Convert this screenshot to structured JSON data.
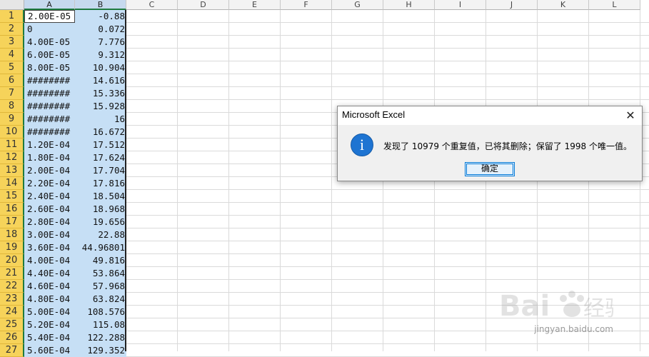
{
  "columns": [
    {
      "label": "A"
    },
    {
      "label": "B"
    },
    {
      "label": "C"
    },
    {
      "label": "D"
    },
    {
      "label": "E"
    },
    {
      "label": "F"
    },
    {
      "label": "G"
    },
    {
      "label": "H"
    },
    {
      "label": "I"
    },
    {
      "label": "J"
    },
    {
      "label": "K"
    },
    {
      "label": "L"
    }
  ],
  "rows": [
    {
      "num": "1",
      "a": "2.00E-05",
      "b": "-0.88"
    },
    {
      "num": "2",
      "a": "0",
      "b": "0.072"
    },
    {
      "num": "3",
      "a": "4.00E-05",
      "b": "7.776"
    },
    {
      "num": "4",
      "a": "6.00E-05",
      "b": "9.312"
    },
    {
      "num": "5",
      "a": "8.00E-05",
      "b": "10.904"
    },
    {
      "num": "6",
      "a": "########",
      "b": "14.616"
    },
    {
      "num": "7",
      "a": "########",
      "b": "15.336"
    },
    {
      "num": "8",
      "a": "########",
      "b": "15.928"
    },
    {
      "num": "9",
      "a": "########",
      "b": "16"
    },
    {
      "num": "10",
      "a": "########",
      "b": "16.672"
    },
    {
      "num": "11",
      "a": "1.20E-04",
      "b": "17.512"
    },
    {
      "num": "12",
      "a": "1.80E-04",
      "b": "17.624"
    },
    {
      "num": "13",
      "a": "2.00E-04",
      "b": "17.704"
    },
    {
      "num": "14",
      "a": "2.20E-04",
      "b": "17.816"
    },
    {
      "num": "15",
      "a": "2.40E-04",
      "b": "18.504"
    },
    {
      "num": "16",
      "a": "2.60E-04",
      "b": "18.968"
    },
    {
      "num": "17",
      "a": "2.80E-04",
      "b": "19.656"
    },
    {
      "num": "18",
      "a": "3.00E-04",
      "b": "22.88"
    },
    {
      "num": "19",
      "a": "3.60E-04",
      "b": "44.96801"
    },
    {
      "num": "20",
      "a": "4.00E-04",
      "b": "49.816"
    },
    {
      "num": "21",
      "a": "4.40E-04",
      "b": "53.864"
    },
    {
      "num": "22",
      "a": "4.60E-04",
      "b": "57.968"
    },
    {
      "num": "23",
      "a": "4.80E-04",
      "b": "63.824"
    },
    {
      "num": "24",
      "a": "5.00E-04",
      "b": "108.576"
    },
    {
      "num": "25",
      "a": "5.20E-04",
      "b": "115.08"
    },
    {
      "num": "26",
      "a": "5.40E-04",
      "b": "122.288"
    },
    {
      "num": "27",
      "a": "5.60E-04",
      "b": "129.352"
    }
  ],
  "dialog": {
    "title": "Microsoft Excel",
    "close_icon": "close-icon",
    "info_icon": "info-icon",
    "info_glyph": "i",
    "message": "发现了 10979 个重复值，已将其删除；保留了 1998 个唯一值。",
    "ok_label": "确定"
  },
  "watermark": {
    "logo": "Bai经验",
    "url": "jingyan.baidu.com"
  },
  "colors": {
    "selection": "#c6dff5",
    "row_header_selected": "#f6d35a",
    "accent": "#0078d7",
    "info_icon": "#1e74d2"
  }
}
